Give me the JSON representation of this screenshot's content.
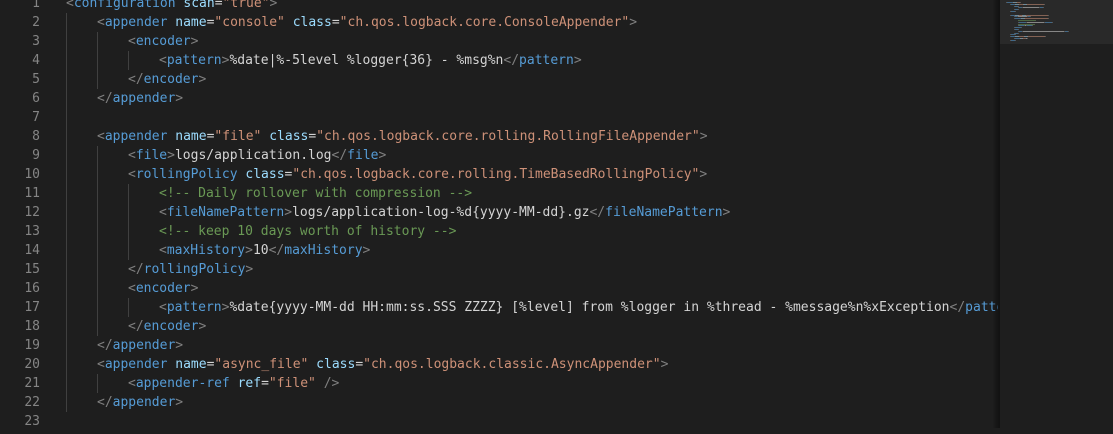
{
  "editor": {
    "language": "xml",
    "colors": {
      "background": "#1e1e1e",
      "line_number": "#858585",
      "punctuation": "#808080",
      "tag": "#569cd6",
      "attribute": "#9cdcfe",
      "string": "#ce9178",
      "text": "#d4d4d4",
      "comment": "#6a9955"
    },
    "lines": [
      {
        "number": "1",
        "indent": 0,
        "tokens": [
          [
            "p",
            "<"
          ],
          [
            "tag",
            "configuration"
          ],
          [
            "t",
            " "
          ],
          [
            "attr",
            "scan"
          ],
          [
            "eq",
            "="
          ],
          [
            "str",
            "\"true\""
          ],
          [
            "p",
            ">"
          ]
        ]
      },
      {
        "number": "2",
        "indent": 1,
        "tokens": [
          [
            "p",
            "<"
          ],
          [
            "tag",
            "appender"
          ],
          [
            "t",
            " "
          ],
          [
            "attr",
            "name"
          ],
          [
            "eq",
            "="
          ],
          [
            "str",
            "\"console\""
          ],
          [
            "t",
            " "
          ],
          [
            "attr",
            "class"
          ],
          [
            "eq",
            "="
          ],
          [
            "str",
            "\"ch.qos.logback.core.ConsoleAppender\""
          ],
          [
            "p",
            ">"
          ]
        ]
      },
      {
        "number": "3",
        "indent": 2,
        "tokens": [
          [
            "p",
            "<"
          ],
          [
            "tag",
            "encoder"
          ],
          [
            "p",
            ">"
          ]
        ]
      },
      {
        "number": "4",
        "indent": 3,
        "tokens": [
          [
            "p",
            "<"
          ],
          [
            "tag",
            "pattern"
          ],
          [
            "p",
            ">"
          ],
          [
            "t",
            "%date|%-5level %logger{36} - %msg%n"
          ],
          [
            "p",
            "</"
          ],
          [
            "tag",
            "pattern"
          ],
          [
            "p",
            ">"
          ]
        ]
      },
      {
        "number": "5",
        "indent": 2,
        "tokens": [
          [
            "p",
            "</"
          ],
          [
            "tag",
            "encoder"
          ],
          [
            "p",
            ">"
          ]
        ]
      },
      {
        "number": "6",
        "indent": 1,
        "tokens": [
          [
            "p",
            "</"
          ],
          [
            "tag",
            "appender"
          ],
          [
            "p",
            ">"
          ]
        ]
      },
      {
        "number": "7",
        "indent": 0,
        "tokens": []
      },
      {
        "number": "8",
        "indent": 1,
        "tokens": [
          [
            "p",
            "<"
          ],
          [
            "tag",
            "appender"
          ],
          [
            "t",
            " "
          ],
          [
            "attr",
            "name"
          ],
          [
            "eq",
            "="
          ],
          [
            "str",
            "\"file\""
          ],
          [
            "t",
            " "
          ],
          [
            "attr",
            "class"
          ],
          [
            "eq",
            "="
          ],
          [
            "str",
            "\"ch.qos.logback.core.rolling.RollingFileAppender\""
          ],
          [
            "p",
            ">"
          ]
        ]
      },
      {
        "number": "9",
        "indent": 2,
        "tokens": [
          [
            "p",
            "<"
          ],
          [
            "tag",
            "file"
          ],
          [
            "p",
            ">"
          ],
          [
            "t",
            "logs/application.log"
          ],
          [
            "p",
            "</"
          ],
          [
            "tag",
            "file"
          ],
          [
            "p",
            ">"
          ]
        ]
      },
      {
        "number": "10",
        "indent": 2,
        "tokens": [
          [
            "p",
            "<"
          ],
          [
            "tag",
            "rollingPolicy"
          ],
          [
            "t",
            " "
          ],
          [
            "attr",
            "class"
          ],
          [
            "eq",
            "="
          ],
          [
            "str",
            "\"ch.qos.logback.core.rolling.TimeBasedRollingPolicy\""
          ],
          [
            "p",
            ">"
          ]
        ]
      },
      {
        "number": "11",
        "indent": 3,
        "tokens": [
          [
            "c",
            "<!-- Daily rollover with compression -->"
          ]
        ]
      },
      {
        "number": "12",
        "indent": 3,
        "tokens": [
          [
            "p",
            "<"
          ],
          [
            "tag",
            "fileNamePattern"
          ],
          [
            "p",
            ">"
          ],
          [
            "t",
            "logs/application-log-%d{yyyy-MM-dd}.gz"
          ],
          [
            "p",
            "</"
          ],
          [
            "tag",
            "fileNamePattern"
          ],
          [
            "p",
            ">"
          ]
        ]
      },
      {
        "number": "13",
        "indent": 3,
        "tokens": [
          [
            "c",
            "<!-- keep 10 days worth of history -->"
          ]
        ]
      },
      {
        "number": "14",
        "indent": 3,
        "tokens": [
          [
            "p",
            "<"
          ],
          [
            "tag",
            "maxHistory"
          ],
          [
            "p",
            ">"
          ],
          [
            "t",
            "10"
          ],
          [
            "p",
            "</"
          ],
          [
            "tag",
            "maxHistory"
          ],
          [
            "p",
            ">"
          ]
        ]
      },
      {
        "number": "15",
        "indent": 2,
        "tokens": [
          [
            "p",
            "</"
          ],
          [
            "tag",
            "rollingPolicy"
          ],
          [
            "p",
            ">"
          ]
        ]
      },
      {
        "number": "16",
        "indent": 2,
        "tokens": [
          [
            "p",
            "<"
          ],
          [
            "tag",
            "encoder"
          ],
          [
            "p",
            ">"
          ]
        ]
      },
      {
        "number": "17",
        "indent": 3,
        "tokens": [
          [
            "p",
            "<"
          ],
          [
            "tag",
            "pattern"
          ],
          [
            "p",
            ">"
          ],
          [
            "t",
            "%date{yyyy-MM-dd HH:mm:ss.SSS ZZZZ} [%level] from %logger in %thread - %message%n%xException"
          ],
          [
            "p",
            "</"
          ],
          [
            "tag",
            "pattern"
          ],
          [
            "p",
            ">"
          ]
        ]
      },
      {
        "number": "18",
        "indent": 2,
        "tokens": [
          [
            "p",
            "</"
          ],
          [
            "tag",
            "encoder"
          ],
          [
            "p",
            ">"
          ]
        ]
      },
      {
        "number": "19",
        "indent": 1,
        "tokens": [
          [
            "p",
            "</"
          ],
          [
            "tag",
            "appender"
          ],
          [
            "p",
            ">"
          ]
        ]
      },
      {
        "number": "20",
        "indent": 1,
        "tokens": [
          [
            "p",
            "<"
          ],
          [
            "tag",
            "appender"
          ],
          [
            "t",
            " "
          ],
          [
            "attr",
            "name"
          ],
          [
            "eq",
            "="
          ],
          [
            "str",
            "\"async_file\""
          ],
          [
            "t",
            " "
          ],
          [
            "attr",
            "class"
          ],
          [
            "eq",
            "="
          ],
          [
            "str",
            "\"ch.qos.logback.classic.AsyncAppender\""
          ],
          [
            "p",
            ">"
          ]
        ]
      },
      {
        "number": "21",
        "indent": 2,
        "tokens": [
          [
            "p",
            "<"
          ],
          [
            "tag",
            "appender-ref"
          ],
          [
            "t",
            " "
          ],
          [
            "attr",
            "ref"
          ],
          [
            "eq",
            "="
          ],
          [
            "str",
            "\"file\""
          ],
          [
            "t",
            " "
          ],
          [
            "p",
            "/>"
          ]
        ]
      },
      {
        "number": "22",
        "indent": 1,
        "tokens": [
          [
            "p",
            "</"
          ],
          [
            "tag",
            "appender"
          ],
          [
            "p",
            ">"
          ]
        ]
      },
      {
        "number": "23",
        "indent": 0,
        "tokens": []
      }
    ]
  }
}
